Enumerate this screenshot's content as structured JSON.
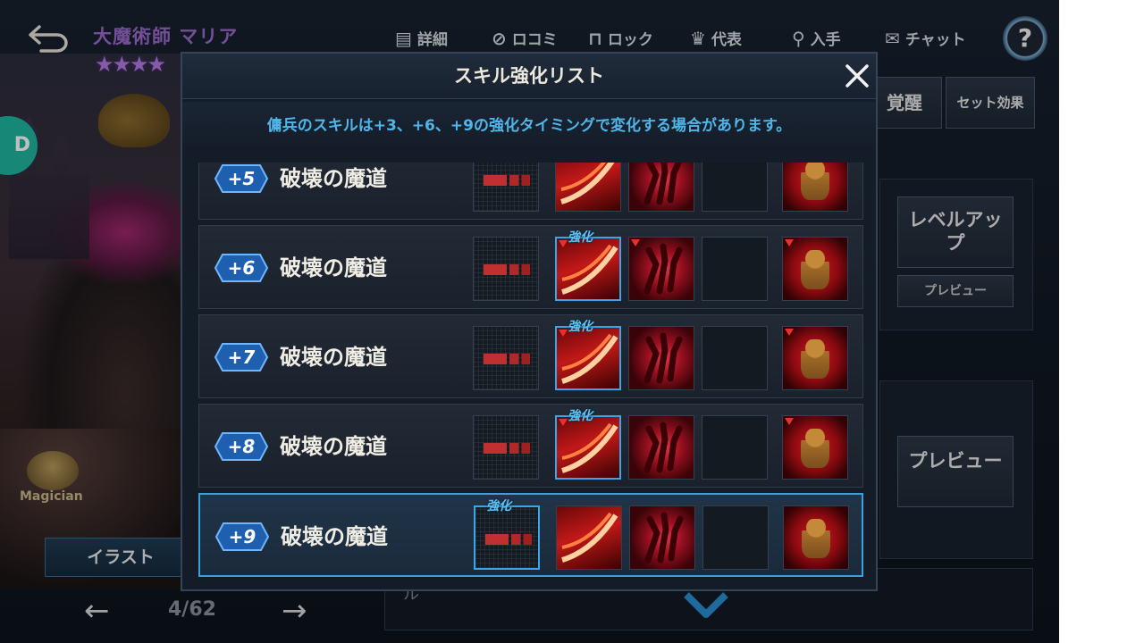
{
  "character": {
    "name": "大魔術師 マリア",
    "stars": "★★★★",
    "side_tab_glyph": "D",
    "class_label": "Magician",
    "illust_button": "イラスト",
    "nav_prev": "←",
    "nav_next": "→",
    "page_counter": "4/62"
  },
  "toolbar": {
    "back_icon": "back-arrow-icon",
    "details": "詳細",
    "reviews": "ロコミ",
    "lock": "ロック",
    "representative": "代表",
    "obtain": "入手",
    "chat": "チャット",
    "help": "?"
  },
  "right_panel": {
    "tab_awaken": "覚醒",
    "tab_set_effect": "セット効果",
    "level_up_button": "レベルアップ",
    "level_up_preview": "プレビュー",
    "preview_button": "プレビュー",
    "partial_text": "ル"
  },
  "modal": {
    "title": "スキル強化リスト",
    "notice": "傭兵のスキルは+3、+6、+9の強化タイミングで変化する場合があります。",
    "enhance_tag": "強化",
    "rows": [
      {
        "level": "+5",
        "skill": "破壊の魔道"
      },
      {
        "level": "+6",
        "skill": "破壊の魔道"
      },
      {
        "level": "+7",
        "skill": "破壊の魔道"
      },
      {
        "level": "+8",
        "skill": "破壊の魔道"
      },
      {
        "level": "+9",
        "skill": "破壊の魔道"
      }
    ]
  },
  "colors": {
    "accent_blue": "#3aa6ea",
    "notice_text": "#4fb6ea",
    "name_purple": "#9a6acb"
  }
}
